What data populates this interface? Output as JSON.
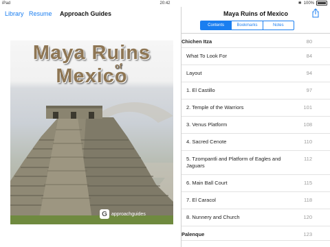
{
  "status": {
    "device": "iPad",
    "time": "20:42",
    "battery": "100%",
    "battery_level": 1.0
  },
  "left_nav": {
    "library": "Library",
    "resume": "Resume",
    "title": "Approach Guides"
  },
  "cover": {
    "title_line1": "Maya Ruins",
    "title_of": "of",
    "title_line2": "Mexico",
    "logo_text": "approachguides",
    "logo_mark": "G"
  },
  "right_nav": {
    "title": "Maya Ruins of Mexico"
  },
  "tabs": [
    "Contents",
    "Bookmarks",
    "Notes"
  ],
  "toc": [
    {
      "label": "Chichen Itza",
      "page": "80",
      "kind": "sec"
    },
    {
      "label": "What To Look For",
      "page": "84",
      "kind": "sub"
    },
    {
      "label": "Layout",
      "page": "94",
      "kind": "sub"
    },
    {
      "label": "1. El Castillo",
      "page": "97",
      "kind": "sub"
    },
    {
      "label": "2. Temple of the Warriors",
      "page": "101",
      "kind": "sub"
    },
    {
      "label": "3. Venus Platform",
      "page": "108",
      "kind": "sub"
    },
    {
      "label": "4. Sacred Cenote",
      "page": "110",
      "kind": "sub"
    },
    {
      "label": "5. Tzompantli and Platform of Eagles and Jaguars",
      "page": "112",
      "kind": "sub"
    },
    {
      "label": "6. Main Ball Court",
      "page": "115",
      "kind": "sub"
    },
    {
      "label": "7. El Caracol",
      "page": "118",
      "kind": "sub"
    },
    {
      "label": "8. Nunnery and Church",
      "page": "120",
      "kind": "sub"
    },
    {
      "label": "Palenque",
      "page": "123",
      "kind": "sec"
    }
  ]
}
